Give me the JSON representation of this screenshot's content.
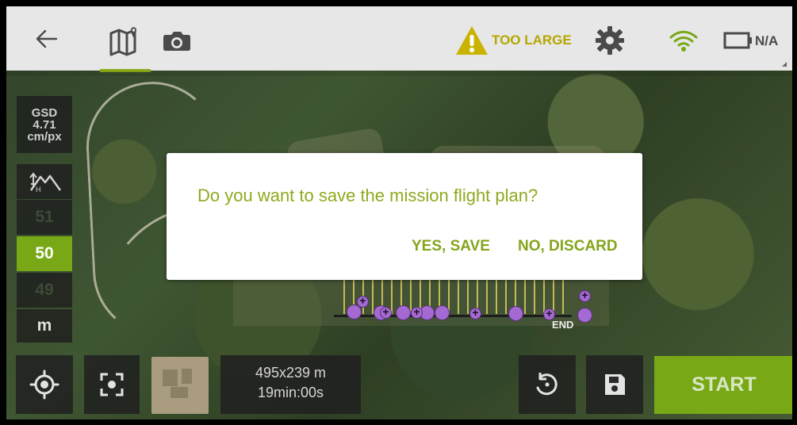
{
  "status": {
    "warning_text": "TOO LARGE",
    "battery_text": "N/A"
  },
  "mission_parameters": {
    "gsd_label": "GSD",
    "gsd_value": "4.71",
    "gsd_unit": "cm/px",
    "altitude_above": "51",
    "altitude_selected": "50",
    "altitude_below": "49",
    "altitude_unit": "m"
  },
  "map": {
    "end_marker": "END"
  },
  "dialog": {
    "message": "Do you want to save the mission flight plan?",
    "yes_label": "YES, SAVE",
    "no_label": "NO, DISCARD"
  },
  "mission_summary": {
    "area": "495x239 m",
    "duration": "19min:00s"
  },
  "actions": {
    "start_label": "START"
  },
  "icons": {
    "back": "back-arrow-icon",
    "map": "map-mission-icon",
    "camera": "camera-icon",
    "warning": "warning-icon",
    "settings": "gear-icon",
    "wifi": "wifi-icon",
    "battery": "battery-icon",
    "locate": "locate-icon",
    "focus": "focus-icon",
    "history": "history-icon",
    "save": "save-icon"
  },
  "colors": {
    "accent": "#78a816",
    "dialog_text": "#8cab1e",
    "warning": "#b6a600"
  }
}
